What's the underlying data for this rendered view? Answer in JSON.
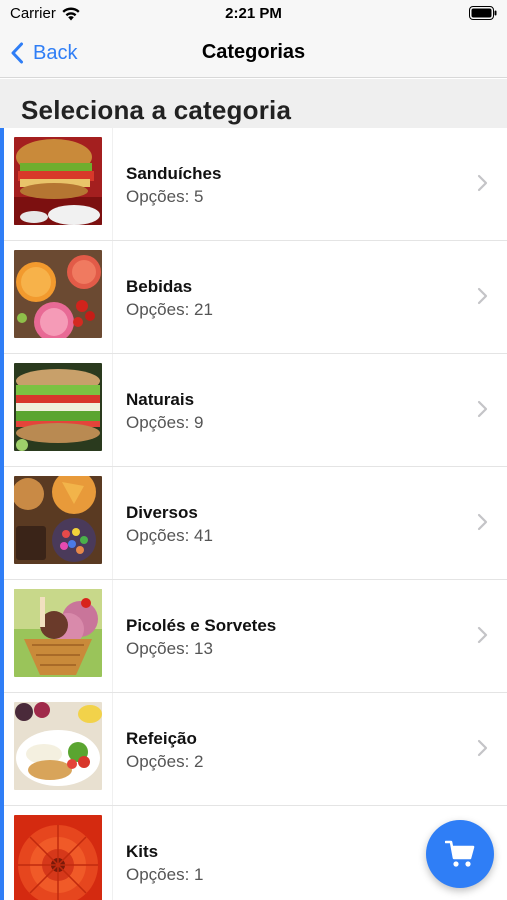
{
  "status_bar": {
    "carrier": "Carrier",
    "time": "2:21 PM",
    "icons": [
      "wifi-icon",
      "battery-icon"
    ]
  },
  "nav": {
    "back_label": "Back",
    "title": "Categorias"
  },
  "section": {
    "title": "Seleciona a categoria"
  },
  "colors": {
    "accent": "#2f7ef6",
    "nav_background": "#f7f7f7",
    "section_background": "#efefef"
  },
  "categories": [
    {
      "name": "Sanduíches",
      "subtitle": "Opções: 5",
      "icon": "sandwich-image"
    },
    {
      "name": "Bebidas",
      "subtitle": "Opções: 21",
      "icon": "drinks-image"
    },
    {
      "name": "Naturais",
      "subtitle": "Opções: 9",
      "icon": "natural-sandwich-image"
    },
    {
      "name": "Diversos",
      "subtitle": "Opções: 41",
      "icon": "snacks-image"
    },
    {
      "name": "Picolés e Sorvetes",
      "subtitle": "Opções: 13",
      "icon": "ice-cream-image"
    },
    {
      "name": "Refeição",
      "subtitle": "Opções: 2",
      "icon": "meal-image"
    },
    {
      "name": "Kits",
      "subtitle": "Opções: 1",
      "icon": "flower-image"
    }
  ],
  "cart": {
    "icon": "cart-icon"
  }
}
